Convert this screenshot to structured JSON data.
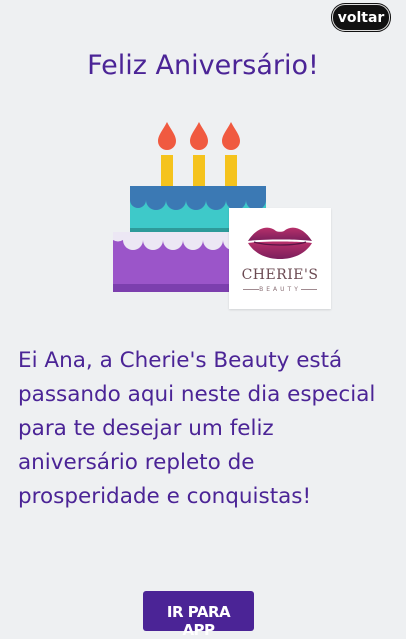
{
  "header": {
    "back_label": "voltar"
  },
  "title": "Feliz Aniversário!",
  "logo": {
    "name": "CHERIE'S",
    "subtitle": "BEAUTY"
  },
  "message": "Ei Ana, a Cherie's Beauty está passando aqui neste dia especial para te desejar um feliz aniversário repleto de prosperidade e conquistas!",
  "cta": {
    "label": "IR PARA APP"
  },
  "colors": {
    "brand": "#4b2496",
    "cake_top": "#3ec9c9",
    "cake_bottom": "#9b55c9",
    "candle": "#f5c31d",
    "flame": "#f05a40"
  },
  "icons": [
    "birthday-cake-icon",
    "lips-logo-icon"
  ]
}
